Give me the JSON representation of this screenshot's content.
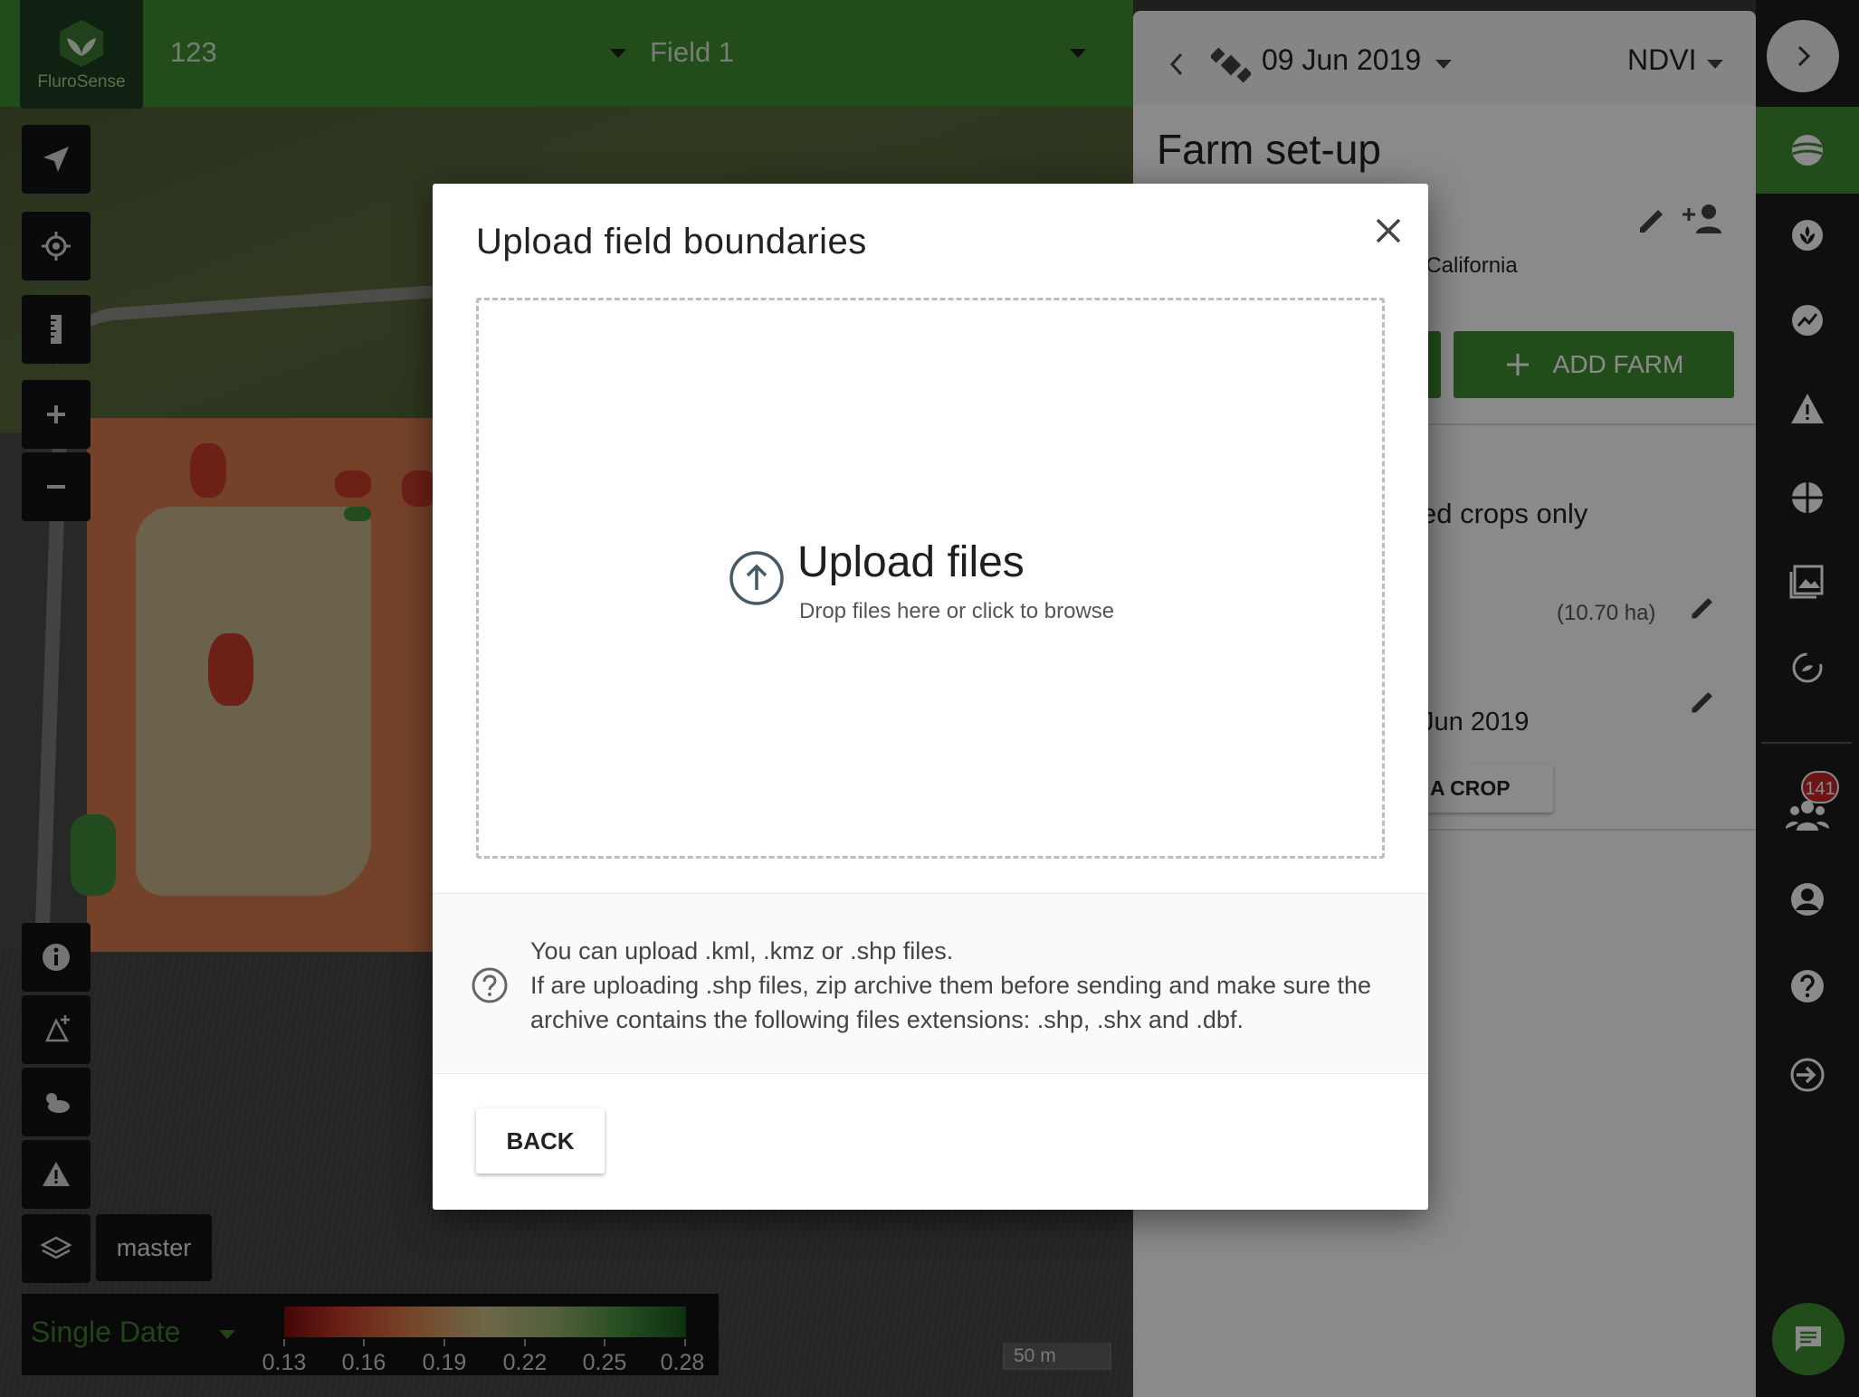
{
  "app": {
    "brand": "FluroSense"
  },
  "topbar": {
    "farm_selector": "123",
    "field_selector": "Field 1"
  },
  "map_tools": {
    "layer_label": "master"
  },
  "legend": {
    "mode": "Single Date",
    "ticks": [
      "0.13",
      "0.16",
      "0.19",
      "0.22",
      "0.25",
      "0.28"
    ],
    "colors": [
      "#7c0d0d",
      "#c73b2a",
      "#d9824c",
      "#cbbf86",
      "#96b16b",
      "#3f8b3c",
      "#1d5a1f"
    ]
  },
  "scale": {
    "label": "50 m"
  },
  "panel": {
    "date": "09 Jun 2019",
    "layer": "NDVI",
    "title": "Farm set-up",
    "region_partial": ": California",
    "add_farm": "ADD FARM",
    "crops_filter_partial": "ed crops only",
    "area_partial": "(10.70 ha)",
    "date_partial": "Jun 2019",
    "crop_button_partial": "A CROP"
  },
  "rail": {
    "notification_count": "141"
  },
  "modal": {
    "title": "Upload field boundaries",
    "upload_title": "Upload files",
    "upload_subtitle": "Drop files here or click to browse",
    "info_line1": "You can upload .kml, .kmz or .shp files.",
    "info_line2": "If are uploading .shp files, zip archive them before sending and make sure the archive contains the following files extensions: .shp, .shx and .dbf.",
    "back": "BACK"
  },
  "colors": {
    "brand_green": "#3f8e33",
    "rail": "#1d1d1d",
    "badge": "#c62828"
  }
}
